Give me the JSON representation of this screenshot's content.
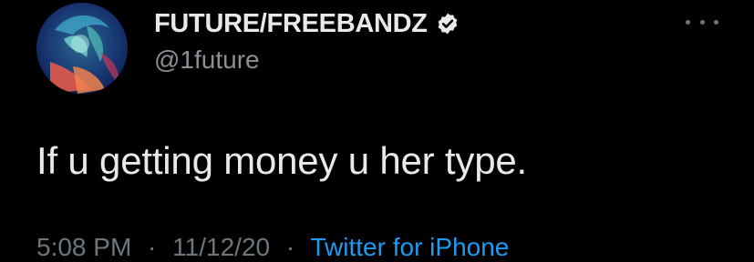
{
  "tweet": {
    "author": {
      "display_name": "FUTURE/FREEBANDZ",
      "handle": "@1future",
      "verified": true,
      "avatar_icon": "profile-avatar-image"
    },
    "more_icon": "ellipsis-icon",
    "text": "If u getting money u her type.",
    "meta": {
      "time": "5:08 PM",
      "separator": "·",
      "date": "11/12/20",
      "source": "Twitter for iPhone"
    }
  },
  "colors": {
    "background": "#000000",
    "primary_text": "#e7e9ea",
    "secondary_text": "#8b9096",
    "link": "#1d9bf0"
  }
}
